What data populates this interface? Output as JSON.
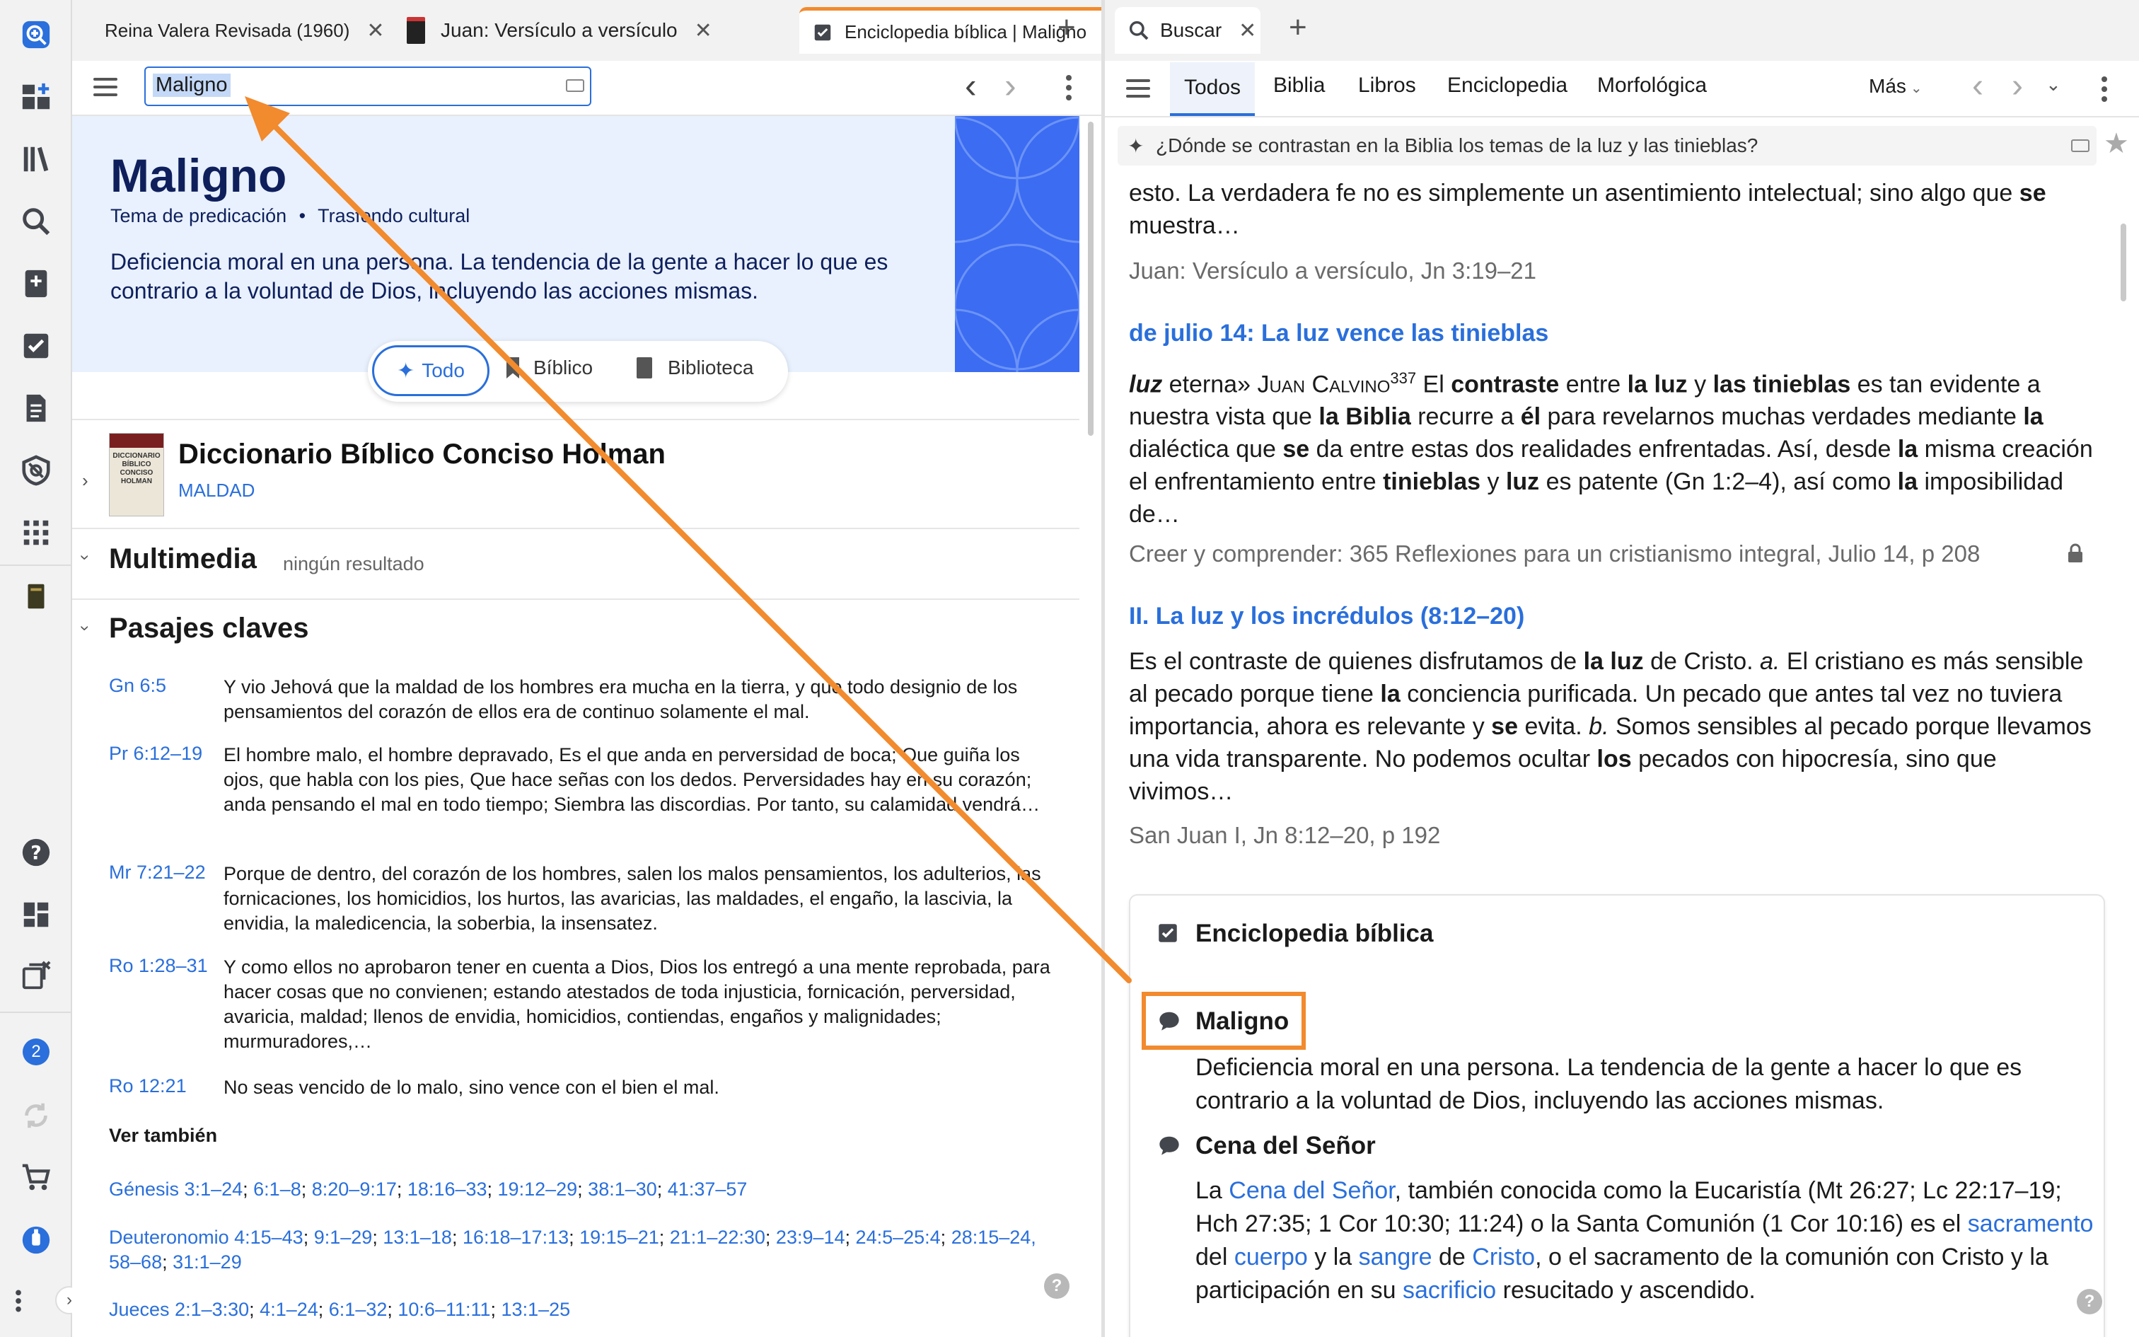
{
  "rail": {
    "icons": [
      "add-panel-icon",
      "dashboard-icon",
      "library-icon",
      "search-icon",
      "notes-icon",
      "checklist-icon",
      "document-icon",
      "lens-icon",
      "apps-icon",
      "bible-book-icon",
      "help-icon",
      "layouts-icon",
      "close-panels-icon",
      "notification-icon",
      "sync-icon",
      "cart-icon",
      "account-icon",
      "more-icon",
      "expand-icon"
    ],
    "notification_count": "2"
  },
  "left_tabs": [
    {
      "label": "Reina Valera Revisada (1960)",
      "close": "✕"
    },
    {
      "label": "Juan: Versículo a versículo",
      "close": "✕"
    },
    {
      "label": "Enciclopedia bíblica | Maligno",
      "close": "✕"
    }
  ],
  "left_toolbar": {
    "search_value": "Maligno",
    "back": "‹",
    "forward": "›"
  },
  "hero": {
    "title": "Maligno",
    "tag1": "Tema de predicación",
    "dot": "•",
    "tag2": "Trasfondo cultural",
    "description": "Deficiencia moral en una persona. La tendencia de la gente a hacer lo que es contrario a la voluntad de Dios, incluyendo las acciones mismas.",
    "filters": [
      "Todo",
      "Bíblico",
      "Biblioteca"
    ]
  },
  "dictionary": {
    "title": "Diccionario Bíblico Conciso Holman",
    "subtitle": "MALDAD",
    "cover_text": "DICCIONARIO BÍBLICO CONCISO HOLMAN"
  },
  "multimedia": {
    "title": "Multimedia",
    "note": "ningún resultado"
  },
  "passages": {
    "title": "Pasajes claves",
    "items": [
      {
        "ref": "Gn 6:5",
        "text": "Y vio Jehová que la maldad de los hombres era mucha en la tierra, y que todo designio de los pensamientos del corazón de ellos era de continuo solamente el mal."
      },
      {
        "ref": "Pr 6:12–19",
        "text": "El hombre malo, el hombre depravado, Es el que anda en perversidad de boca; Que guiña los ojos, que habla con los pies, Que hace señas con los dedos. Perversidades hay en su corazón; anda pensando el mal en todo tiempo; Siembra las discordias. Por tanto, su calamidad vendrá…"
      },
      {
        "ref": "Mr 7:21–22",
        "text": "Porque de dentro, del corazón de los hombres, salen los malos pensamientos, los adulterios, las fornicaciones, los homicidios, los hurtos, las avaricias, las maldades, el engaño, la lascivia, la envidia, la maledicencia, la soberbia, la insensatez."
      },
      {
        "ref": "Ro 1:28–31",
        "text": "Y como ellos no aprobaron tener en cuenta a Dios, Dios los entregó a una mente reprobada, para hacer cosas que no convienen; estando atestados de toda injusticia, fornicación, perversidad, avaricia, maldad; llenos de envidia, homicidios, contiendas, engaños y malignidades; murmuradores,…"
      },
      {
        "ref": "Ro 12:21",
        "text": "No seas vencido de lo malo, sino vence con el bien el mal."
      }
    ],
    "see_also_title": "Ver también",
    "see_also": [
      {
        "book": "Génesis 3:1–24",
        "refs": [
          "6:1–8",
          "8:20–9:17",
          "18:16–33",
          "19:12–29",
          "38:1–30",
          "41:37–57"
        ]
      },
      {
        "book": "Deuteronomio 4:15–43",
        "refs": [
          "9:1–29",
          "13:1–18",
          "16:18–17:13",
          "19:15–21",
          "21:1–22:30",
          "23:9–14",
          "24:5–25:4",
          "28:15–24, 58–68",
          "31:1–29"
        ]
      },
      {
        "book": "Jueces 2:1–3:30",
        "refs": [
          "4:1–24",
          "6:1–32",
          "10:6–11:11",
          "13:1–25"
        ]
      }
    ]
  },
  "right_tabs": [
    {
      "label": "Buscar",
      "close": "✕"
    }
  ],
  "right_toolbar": {
    "tabs": [
      "Todos",
      "Biblia",
      "Libros",
      "Enciclopedia",
      "Morfológica"
    ],
    "more": "Más",
    "query": "¿Dónde se contrastan en la Biblia los temas de la luz y las tinieblas?"
  },
  "results": [
    {
      "lead": "esto. La verdadera fe no es simplemente un asentimiento intelectual; sino algo que ",
      "lead_bold": "se",
      "lead2": " muestra…",
      "source": "Juan: Versículo a versículo, Jn 3:19–21"
    },
    {
      "title": "de julio 14: La luz vence las tinieblas",
      "p1": "luz",
      "p2": " eterna» ",
      "author": "Juan Calvino",
      "sup": "337",
      "p3": " El ",
      "b1": "contraste",
      "p4": " entre ",
      "b2": "la luz",
      "p5": " y ",
      "b3": "las tinieblas",
      "p6": " es tan evidente a nuestra vista que ",
      "b4": "la Biblia",
      "p7": " recurre a ",
      "b5": "él",
      "p8": " para revelarnos muchas verdades mediante ",
      "b6": "la",
      "p9": " dialéctica que ",
      "b7": "se",
      "p10": " da entre estas dos realidades enfrentadas. Así, desde ",
      "b8": "la",
      "p11": " misma creación el enfrentamiento entre ",
      "b9": "tinieblas",
      "p12": " y ",
      "b10": "luz",
      "p13": " es patente (Gn 1:2–4), así como ",
      "b11": "la",
      "p14": " imposibilidad de…",
      "source": "Creer y comprender: 365 Reflexiones para un cristianismo integral, Julio 14, p 208"
    },
    {
      "title": "II. La luz y los incrédulos (8:12–20)",
      "p1": "Es el contraste de quienes disfrutamos de ",
      "b1": "la luz",
      "p2": " de Cristo. ",
      "i1": "a.",
      "p3": " El cristiano es más sensible al pecado porque tiene ",
      "b2": "la",
      "p4": " conciencia purificada. Un pecado que antes tal vez no tuviera importancia, ahora es relevante y ",
      "b3": "se",
      "p5": " evita. ",
      "i2": "b.",
      "p6": " Somos sensibles al pecado porque llevamos una vida transparente. No podemos ocultar ",
      "b4": "los",
      "p7": " pecados con hipocresía, sino que vivimos…",
      "source": "San Juan I, Jn 8:12–20, p 192"
    }
  ],
  "encyclopedia_card": {
    "title": "Enciclopedia bíblica",
    "entry1_title": "Maligno",
    "entry1_text": "Deficiencia moral en una persona. La tendencia de la gente a hacer lo que es contrario a la voluntad de Dios, incluyendo las acciones mismas.",
    "entry2_title": "Cena del Señor",
    "e2": {
      "t1": "La ",
      "l1": "Cena del Señor",
      "t2": ", también conocida como la Eucaristía (Mt 26:27; Lc 22:17–19; Hch 27:35; 1 Cor 10:30; 11:24) o la Santa Comunión (1 Cor 10:16) es el ",
      "l2": "sacramento",
      "t3": " del ",
      "l3": "cuerpo",
      "t4": " y la ",
      "l4": "sangre",
      "t5": " de ",
      "l5": "Cristo",
      "t6": ", o el sacramento de la comunión con Cristo y la participación en su ",
      "l6": "sacrificio",
      "t7": " resucitado y ascendido."
    }
  },
  "help_glyph": "?",
  "colors": {
    "accent_orange": "#f28a2e",
    "link_blue": "#2a6fdb",
    "title_navy": "#0f1f5c",
    "hero_bg": "#e8f1fd",
    "pattern_blue": "#3b6cf2"
  }
}
